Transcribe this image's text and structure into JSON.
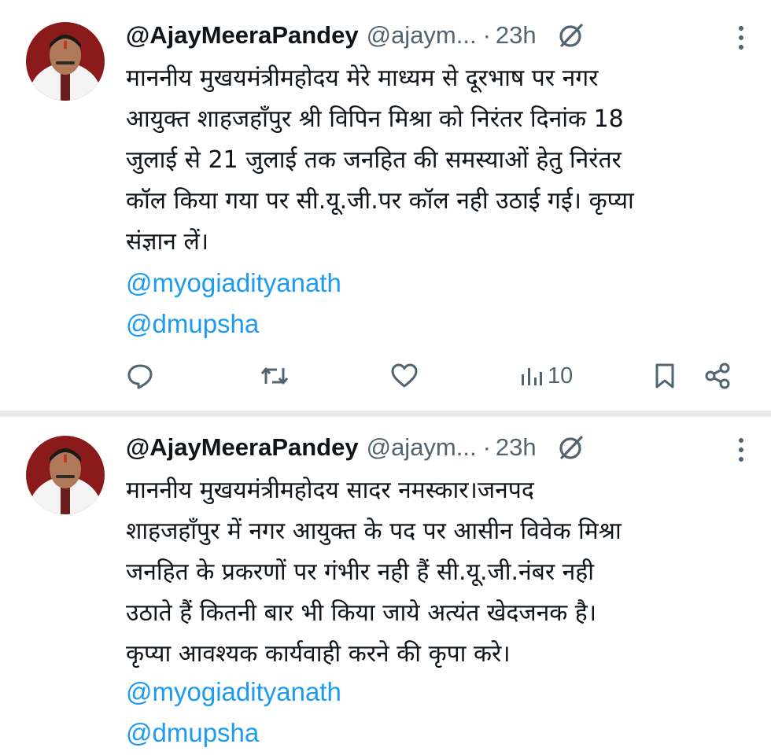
{
  "tweets": [
    {
      "display_name": "@AjayMeeraPandey",
      "handle": "@ajaym...",
      "separator": "·",
      "time": "23h",
      "text_lines": [
        "माननीय मुखयमंत्रीमहोदय मेरे माध्यम से दूरभाष पर नगर",
        "आयुक्त शाहजहाँपुर श्री विपिन मिश्रा को निरंतर दिनांक 18",
        "जुलाई से 21 जुलाई तक जनहित की समस्याओं हेतु निरंतर",
        "कॉल किया गया पर सी.यू.जी.पर कॉल नही उठाई गई। कृप्या",
        "संज्ञान लें।"
      ],
      "mentions": [
        "@myogiadityanath",
        "@dmupsha"
      ],
      "actions": {
        "reply_icon": "reply-icon",
        "retweet_icon": "retweet-icon",
        "like_icon": "heart-icon",
        "views_icon": "views-icon",
        "views_count": "10",
        "bookmark_icon": "bookmark-icon",
        "share_icon": "share-icon"
      }
    },
    {
      "display_name": "@AjayMeeraPandey",
      "handle": "@ajaym...",
      "separator": "·",
      "time": "23h",
      "text_lines": [
        "माननीय मुखयमंत्रीमहोदय सादर नमस्कार।जनपद",
        "शाहजहाँपुर में नगर आयुक्त के पद पर आसीन विवेक मिश्रा",
        "जनहित के प्रकरणों पर गंभीर नही हैं सी.यू.जी.नंबर नही",
        "उठाते हैं कितनी बार भी किया जाये अत्यंत खेदजनक है।",
        "कृप्या आवश्यक कार्यवाही करने की कृपा करे।"
      ],
      "mentions": [
        "@myogiadityanath",
        "@dmupsha"
      ]
    }
  ],
  "colors": {
    "text": "#0f1419",
    "secondary": "#536471",
    "link": "#1d9bf0",
    "divider": "#e7e9ea"
  }
}
